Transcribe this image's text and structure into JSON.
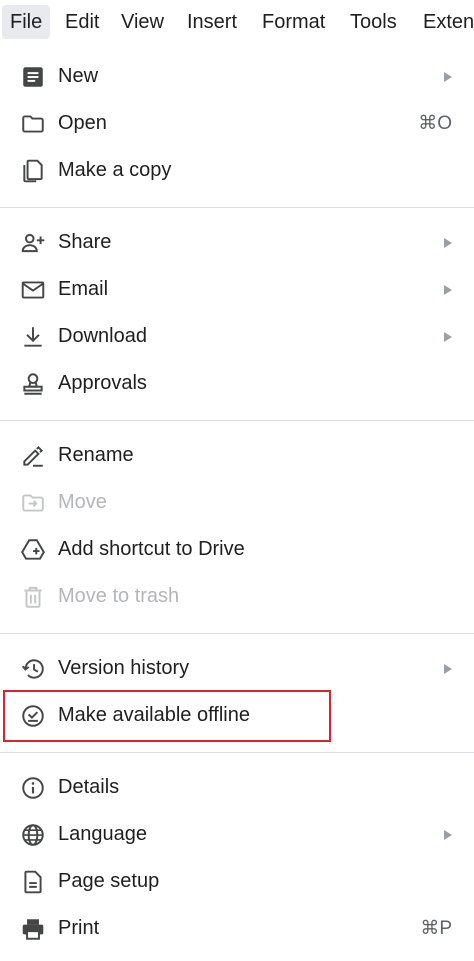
{
  "menubar": {
    "items": [
      {
        "label": "File"
      },
      {
        "label": "Edit"
      },
      {
        "label": "View"
      },
      {
        "label": "Insert"
      },
      {
        "label": "Format"
      },
      {
        "label": "Tools"
      },
      {
        "label": "Exten"
      }
    ]
  },
  "file_menu": {
    "items": [
      {
        "label": "New",
        "icon": "new-document-icon",
        "submenu": true
      },
      {
        "label": "Open",
        "icon": "folder-icon",
        "shortcut": "⌘O"
      },
      {
        "label": "Make a copy",
        "icon": "copy-icon"
      },
      {
        "label": "Share",
        "icon": "share-person-add-icon",
        "submenu": true
      },
      {
        "label": "Email",
        "icon": "email-icon",
        "submenu": true
      },
      {
        "label": "Download",
        "icon": "download-icon",
        "submenu": true
      },
      {
        "label": "Approvals",
        "icon": "approvals-stamp-icon"
      },
      {
        "label": "Rename",
        "icon": "rename-pencil-icon"
      },
      {
        "label": "Move",
        "icon": "move-folder-icon",
        "disabled": true
      },
      {
        "label": "Add shortcut to Drive",
        "icon": "drive-shortcut-icon"
      },
      {
        "label": "Move to trash",
        "icon": "trash-icon",
        "disabled": true
      },
      {
        "label": "Version history",
        "icon": "history-icon",
        "submenu": true
      },
      {
        "label": "Make available offline",
        "icon": "offline-check-icon",
        "highlighted": true
      },
      {
        "label": "Details",
        "icon": "info-icon"
      },
      {
        "label": "Language",
        "icon": "globe-icon",
        "submenu": true
      },
      {
        "label": "Page setup",
        "icon": "page-setup-icon"
      },
      {
        "label": "Print",
        "icon": "printer-icon",
        "shortcut": "⌘P"
      }
    ]
  },
  "colors": {
    "text": "#1f1f1f",
    "disabled_text": "#b4b6b9",
    "icon": "#444746",
    "divider": "#dadce0",
    "highlight_border": "#d9232e",
    "active_menu_bg": "#e8eaf0"
  }
}
